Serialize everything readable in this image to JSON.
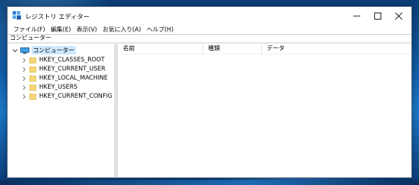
{
  "window": {
    "title": "レジストリ エディター",
    "icon": "regedit-icon",
    "controls": {
      "minimize": "—",
      "maximize": "☐",
      "close": "✕"
    }
  },
  "menu": {
    "items": [
      "ファイル(F)",
      "編集(E)",
      "表示(V)",
      "お気に入り(A)",
      "ヘルプ(H)"
    ]
  },
  "address": "コンピューター",
  "tree": {
    "root": {
      "label": "コンピューター",
      "icon": "computer-icon",
      "expanded": true
    },
    "children": [
      {
        "label": "HKEY_CLASSES_ROOT",
        "icon": "folder-icon"
      },
      {
        "label": "HKEY_CURRENT_USER",
        "icon": "folder-icon"
      },
      {
        "label": "HKEY_LOCAL_MACHINE",
        "icon": "folder-icon"
      },
      {
        "label": "HKEY_USERS",
        "icon": "folder-icon"
      },
      {
        "label": "HKEY_CURRENT_CONFIG",
        "icon": "folder-icon"
      }
    ]
  },
  "list": {
    "columns": [
      "名前",
      "種類",
      "データ"
    ]
  },
  "colors": {
    "selection": "#cce8ff",
    "folder": "#f5d77a",
    "accent": "#1d78c8"
  }
}
